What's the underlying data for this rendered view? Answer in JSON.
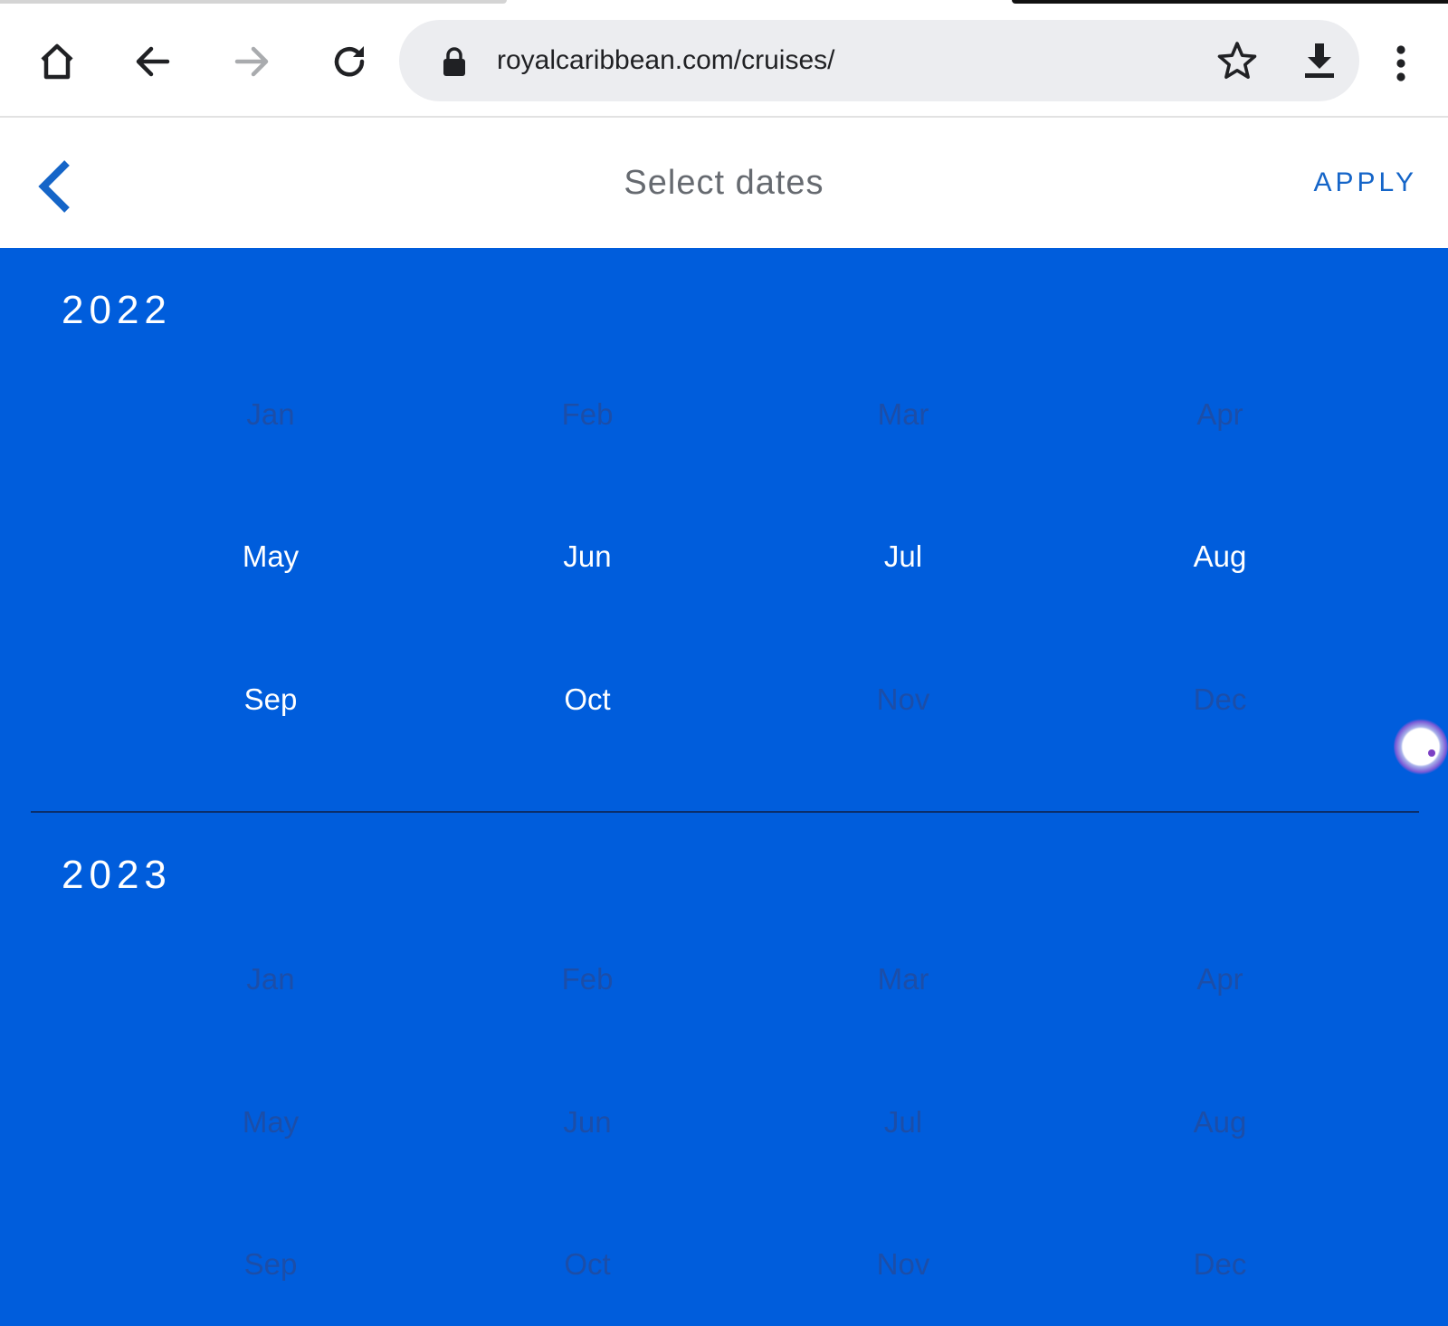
{
  "browser": {
    "url": "royalcaribbean.com/cruises/",
    "icons": {
      "home": "home-icon",
      "back": "arrow-left-icon",
      "forward": "arrow-right-icon",
      "reload": "reload-icon",
      "lock": "lock-icon",
      "bookmark": "star-icon",
      "download": "download-icon",
      "menu": "more-vertical-icon"
    }
  },
  "header": {
    "title": "Select dates",
    "apply_label": "APPLY",
    "back_icon": "chevron-left-icon"
  },
  "colors": {
    "calendar_bg": "#005ddc",
    "available_month": "#ffffff",
    "unavailable_month": "#1c4ea8",
    "accent": "#1565c8"
  },
  "years": [
    {
      "year": "2022",
      "months": [
        {
          "label": "Jan",
          "available": false
        },
        {
          "label": "Feb",
          "available": false
        },
        {
          "label": "Mar",
          "available": false
        },
        {
          "label": "Apr",
          "available": false
        },
        {
          "label": "May",
          "available": true
        },
        {
          "label": "Jun",
          "available": true
        },
        {
          "label": "Jul",
          "available": true
        },
        {
          "label": "Aug",
          "available": true
        },
        {
          "label": "Sep",
          "available": true
        },
        {
          "label": "Oct",
          "available": true
        },
        {
          "label": "Nov",
          "available": false
        },
        {
          "label": "Dec",
          "available": false
        }
      ]
    },
    {
      "year": "2023",
      "months": [
        {
          "label": "Jan",
          "available": false
        },
        {
          "label": "Feb",
          "available": false
        },
        {
          "label": "Mar",
          "available": false
        },
        {
          "label": "Apr",
          "available": false
        },
        {
          "label": "May",
          "available": false
        },
        {
          "label": "Jun",
          "available": false
        },
        {
          "label": "Jul",
          "available": false
        },
        {
          "label": "Aug",
          "available": false
        },
        {
          "label": "Sep",
          "available": false
        },
        {
          "label": "Oct",
          "available": false
        },
        {
          "label": "Nov",
          "available": false
        },
        {
          "label": "Dec",
          "available": false
        }
      ]
    }
  ]
}
